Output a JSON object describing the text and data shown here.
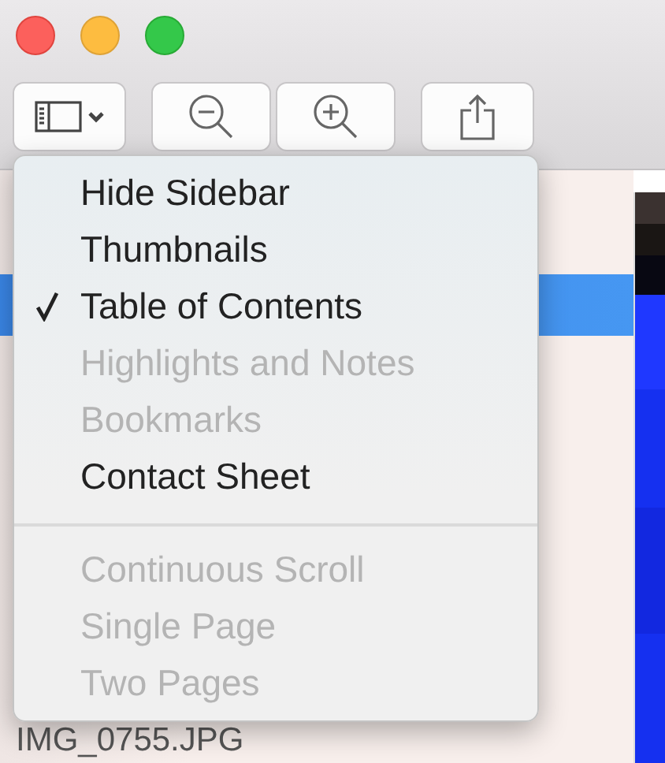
{
  "toolbar": {
    "buttons": [
      {
        "kind": "sidebar"
      },
      {
        "kind": "zoom-out"
      },
      {
        "kind": "zoom-in"
      },
      {
        "kind": "share"
      }
    ]
  },
  "menu": {
    "sections": [
      {
        "items": [
          {
            "label": "Hide Sidebar",
            "checked": false,
            "disabled": false
          },
          {
            "label": "Thumbnails",
            "checked": false,
            "disabled": false
          },
          {
            "label": "Table of Contents",
            "checked": true,
            "disabled": false
          },
          {
            "label": "Highlights and Notes",
            "checked": false,
            "disabled": true
          },
          {
            "label": "Bookmarks",
            "checked": false,
            "disabled": true
          },
          {
            "label": "Contact Sheet",
            "checked": false,
            "disabled": false
          }
        ]
      },
      {
        "items": [
          {
            "label": "Continuous Scroll",
            "checked": false,
            "disabled": true
          },
          {
            "label": "Single Page",
            "checked": false,
            "disabled": true
          },
          {
            "label": "Two Pages",
            "checked": false,
            "disabled": true
          }
        ]
      }
    ]
  },
  "sidebar": {
    "caption": "IMG_0755.JPG"
  }
}
